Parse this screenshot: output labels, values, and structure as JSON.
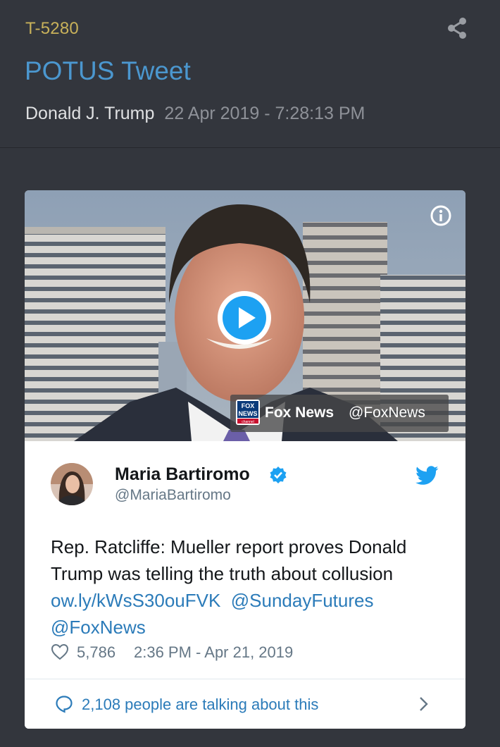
{
  "header": {
    "post_id": "T-5280",
    "title": "POTUS Tweet",
    "author": "Donald J. Trump",
    "timestamp": "22 Apr 2019 - 7:28:13 PM"
  },
  "media": {
    "source_name": "Fox News",
    "source_handle": "@FoxNews",
    "logo_text": [
      "FOX",
      "NEWS",
      "channel"
    ]
  },
  "tweet": {
    "name": "Maria Bartiromo",
    "handle": "@MariaBartiromo",
    "text": "Rep. Ratcliffe: Mueller report proves Donald Trump was telling the truth about collusion",
    "link": "ow.ly/kWsS30ouFVK",
    "mention_1": "@SundayFutures",
    "mention_2": "@FoxNews",
    "likes": "5,786",
    "date": "2:36 PM - Apr 21, 2019",
    "conversation": "2,108 people are talking about this"
  },
  "icons": [
    "share-icon",
    "info-icon",
    "play-icon",
    "verified-icon",
    "twitter-bird-icon",
    "heart-icon",
    "comment-icon",
    "chevron-right-icon"
  ],
  "colors": {
    "background": "#33363d",
    "post_id": "#c8b15a",
    "title": "#4b97cf",
    "link": "#2b7bb9",
    "twitter_blue": "#1da1f2"
  }
}
